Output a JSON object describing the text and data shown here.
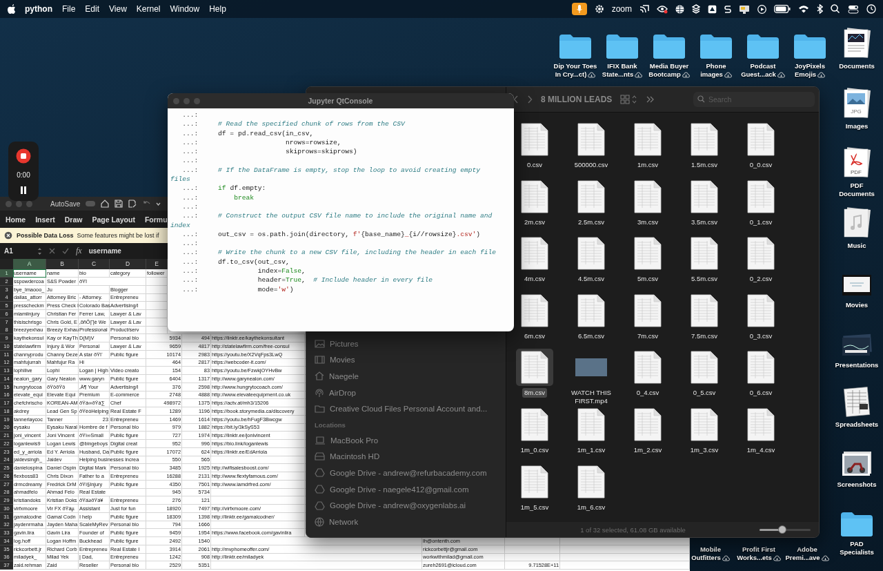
{
  "menubar": {
    "app": "python",
    "menus": [
      "File",
      "Edit",
      "View",
      "Kernel",
      "Window",
      "Help"
    ],
    "status_text": "zoom"
  },
  "desktop": {
    "top_row": [
      {
        "lines": [
          "Dip Your Toes",
          "In Cry...ct)"
        ],
        "cloud": true
      },
      {
        "lines": [
          "IFIX Bank",
          "State...nts"
        ],
        "cloud": true
      },
      {
        "lines": [
          "Media Buyer",
          "Bootcamp"
        ],
        "cloud": true
      },
      {
        "lines": [
          "Phone",
          "images"
        ],
        "cloud": true
      },
      {
        "lines": [
          "Podcast",
          "Guest...ack"
        ],
        "cloud": true
      },
      {
        "lines": [
          "JoyPixels",
          "Emojis"
        ],
        "cloud": true
      }
    ],
    "stacks": [
      {
        "lines": [
          "Documents"
        ],
        "kind": "documents"
      },
      {
        "lines": [
          "Images"
        ],
        "kind": "images",
        "icon_text": "JPG"
      },
      {
        "lines": [
          "PDF",
          "Documents"
        ],
        "kind": "pdf",
        "icon_text": "PDF"
      },
      {
        "lines": [
          "Music"
        ],
        "kind": "music"
      },
      {
        "lines": [
          "Movies"
        ],
        "kind": "movies"
      },
      {
        "lines": [
          "Presentations"
        ],
        "kind": "presentations"
      },
      {
        "lines": [
          "Spreadsheets"
        ],
        "kind": "spreadsheets"
      },
      {
        "lines": [
          "Screenshots"
        ],
        "kind": "screenshots"
      },
      {
        "lines": [
          "PAD",
          "Specialists"
        ],
        "kind": "folder"
      }
    ],
    "bottom_labels": [
      {
        "lines": [
          "Mobile",
          "Outfitters"
        ],
        "cloud": true
      },
      {
        "lines": [
          "Profit First",
          "Works...ets"
        ],
        "cloud": true
      },
      {
        "lines": [
          "Adobe",
          "Premi...ave"
        ],
        "cloud": true
      }
    ]
  },
  "recorder": {
    "time": "0:00"
  },
  "excel": {
    "autosave": "AutoSave",
    "autosave_on": false,
    "ribbon_tabs": [
      "Home",
      "Insert",
      "Draw",
      "Page Layout",
      "Formu"
    ],
    "alert": {
      "title": "Possible Data Loss",
      "message": "Some features might be lost if"
    },
    "name_box": "A1",
    "function_label": "fx",
    "formula": "username",
    "columns": [
      {
        "label": "A",
        "selected": true
      },
      {
        "label": "B",
        "selected": false
      },
      {
        "label": "C",
        "selected": false
      },
      {
        "label": "D",
        "selected": false
      },
      {
        "label": "E",
        "selected": false
      }
    ],
    "rows": [
      {
        "num": "1",
        "selected": true,
        "cells": [
          "username",
          "name",
          "bio",
          "category",
          "follower"
        ]
      },
      {
        "num": "2",
        "selected": false,
        "cells": [
          "sspowdercoa",
          "S&S Powder",
          "ðŸï",
          null
        ]
      },
      {
        "num": "3",
        "selected": false,
        "cells": [
          "bye_lmaooo_",
          "Ju",
          null,
          "Blogger"
        ]
      },
      {
        "num": "4",
        "selected": false,
        "cells": [
          "dallas_attorr",
          "Attorney Bric",
          "- Attorney.",
          "Entrepreneu"
        ]
      },
      {
        "num": "5",
        "selected": false,
        "cells": [
          "presscheckm",
          "Press Check I",
          "Colorado Bas",
          "Advertising/I"
        ]
      },
      {
        "num": "6",
        "selected": false,
        "cells": [
          "miamiinjury",
          "Christian Fer",
          "Ferrer Law,",
          "Lawyer & Lav"
        ]
      },
      {
        "num": "7",
        "selected": false,
        "cells": [
          "thisischrisgo",
          "Chris Gold, E",
          "‚õñÔ∏è We",
          "Lawyer & Lav"
        ]
      },
      {
        "num": "8",
        "selected": false,
        "cells": [
          "breezyexhau",
          "Breezy Exhau",
          "Professional",
          "Product/serv"
        ]
      },
      {
        "num": "9",
        "selected": false,
        "cells": [
          "kaythekonsul",
          "Kay or KayTh",
          "D(M)V",
          "Personal blo",
          "5934",
          "494",
          "https://linktr.ee/kaythekonsultant"
        ]
      },
      {
        "num": "10",
        "selected": false,
        "cells": [
          "statelawfirm",
          "Injury & Wor",
          "Personal",
          "Lawyer & Lav",
          "9659",
          "4817",
          "http://statelawfirm.com/free-consul"
        ]
      },
      {
        "num": "11",
        "selected": false,
        "cells": [
          "channyprodu",
          "Channy Deze",
          "A star ðŸï´",
          "Public figure",
          "10174",
          "2983",
          "https://youtu.be/X2VqFps3LwQ"
        ]
      },
      {
        "num": "12",
        "selected": false,
        "cells": [
          "mahfujurrah",
          "Mahfujur Ra",
          "Hi",
          null,
          "464",
          "2817",
          "https://webcoder-it.com/"
        ]
      },
      {
        "num": "13",
        "selected": false,
        "cells": [
          "lophilive",
          "Lophi",
          "Logan | High",
          "Video creato",
          "154",
          "83",
          "https://youtu.be/FzwkjOYHvBw"
        ]
      },
      {
        "num": "14",
        "selected": false,
        "cells": [
          "nealon_gary",
          "Gary Nealon",
          "www.garyn",
          "Public figure",
          "6404",
          "1317",
          "http://www.garynealon.com/"
        ]
      },
      {
        "num": "15",
        "selected": false,
        "cells": [
          "hungrytocoa",
          "ðŸôðŸô",
          "‚Ä¶ Your",
          "Advertising/I",
          "376",
          "2598",
          "http://www.hungrytocoach.com/"
        ]
      },
      {
        "num": "16",
        "selected": false,
        "cells": [
          "elevate_equi",
          "Elevate Equi",
          "Premium",
          "E-commerce",
          "2748",
          "4888",
          "http://www.elevateequipment.co.uk"
        ]
      },
      {
        "num": "17",
        "selected": false,
        "cells": [
          "chefchrischo",
          "KOREAN-AM",
          "ðŸá∞ðŸá∑",
          "Chef",
          "498972",
          "1375",
          "https://actv.at/mh3/15206"
        ]
      },
      {
        "num": "18",
        "selected": false,
        "cells": [
          "akdrey",
          "Lead Gen Sp",
          "ðŸèòHelping",
          "Real Estate F",
          "1289",
          "1196",
          "https://book.storymedia.ca/discovery"
        ]
      },
      {
        "num": "19",
        "selected": false,
        "cells": [
          "tannerlaycoc",
          "Tanner",
          "23",
          "Entrepreneu",
          "1469",
          "1614",
          "https://youtu.be/hFugF3Bwcgw"
        ]
      },
      {
        "num": "20",
        "selected": false,
        "cells": [
          "eysaku",
          "Eysaku Naral",
          "Hombre de f",
          "Personal blo",
          "979",
          "1882",
          "https://bit.ly/3kSyS53"
        ]
      },
      {
        "num": "21",
        "selected": false,
        "cells": [
          "joni_vincent",
          "Joni Vincent",
          "ðŸí∞Small",
          "Public figure",
          "727",
          "1974",
          "https://linktr.ee/jonivincent"
        ]
      },
      {
        "num": "22",
        "selected": false,
        "cells": [
          "loganlewis9",
          "Logan Lewis",
          "@bingeboys",
          "Digital creat",
          "952",
          "996",
          "https://bio.link/loganlewis"
        ]
      },
      {
        "num": "23",
        "selected": false,
        "cells": [
          "ed_y_arriola",
          "Ed Y. Arriola",
          "Husband, Da",
          "Public figure",
          "17072",
          "624",
          "https://linktr.ee/EdArriola"
        ]
      },
      {
        "num": "24",
        "selected": false,
        "cells": [
          "jaidevsingh_",
          "Jaidev",
          "Helping businesses increa",
          null,
          "550",
          "565"
        ]
      },
      {
        "num": "25",
        "selected": false,
        "cells": [
          "danielospina",
          "Daniel Ospin",
          "Digital Mark",
          "Personal blo",
          "3485",
          "1925",
          "http://wifisalesboost.com/"
        ]
      },
      {
        "num": "26",
        "selected": false,
        "cells": [
          "flexboss83",
          "Chris Dixon",
          "Father to a",
          "Entrepreneu",
          "16288",
          "2131",
          "http://www.flextyfamous.com/"
        ]
      },
      {
        "num": "27",
        "selected": false,
        "cells": [
          "drmcdreamy",
          "Fredrick DrM",
          "ðŸí§Injury",
          "Public figure",
          "4350",
          "7501",
          "http://www.iamdrfred.com/"
        ]
      },
      {
        "num": "28",
        "selected": false,
        "cells": [
          "ahmadfelo",
          "Ahmad Felo",
          "Real Estate",
          null,
          "945",
          "5734"
        ]
      },
      {
        "num": "29",
        "selected": false,
        "cells": [
          "kristiandoks",
          "Kristian Doks",
          "ðŸá≥ðŸá¥",
          "Entrepreneu",
          "276",
          "121"
        ]
      },
      {
        "num": "30",
        "selected": false,
        "cells": [
          "virfxmoore",
          "Vir FX ðŸáµ",
          "Assistant",
          "Just for fun",
          "18920",
          "7497",
          "http://virfxmoore.com/"
        ]
      },
      {
        "num": "31",
        "selected": false,
        "cells": [
          "gamalcodne",
          "Gamal Codn",
          "I help",
          "Public figure",
          "18309",
          "1398",
          "http://linktr.ee/gamalcodner/"
        ]
      },
      {
        "num": "32",
        "selected": false,
        "cells": [
          "jaydenrmaha",
          "Jayden Maha",
          "ScaleMyRev",
          "Personal blo",
          "794",
          "1666"
        ]
      },
      {
        "num": "33",
        "selected": false,
        "cells": [
          "gavin.lira",
          "Gavin Lira",
          "Founder of",
          "Public figure",
          "9459",
          "1954",
          "https://www.facebook.com/gavinlira"
        ]
      },
      {
        "num": "34",
        "selected": false,
        "cells": [
          "log.hoff",
          "Logan Hoffm",
          "Buckhead",
          "Public figure",
          "2492",
          "1540",
          null,
          "lh@ontenth.com"
        ]
      },
      {
        "num": "35",
        "selected": false,
        "cells": [
          "rickcorbett.jr",
          "Richard Corb",
          "Entrepreneu",
          "Real Estate I",
          "3914",
          "2061",
          "http://mvphomeoffer.com/",
          "rickcorbettjr@gmail.com"
        ]
      },
      {
        "num": "36",
        "selected": false,
        "cells": [
          "miladyek_",
          "Milad Yek",
          "| Dad,",
          "Entrepreneu",
          "1242",
          "908",
          "http://linktr.ee/miladyek",
          "workwithmilad@gmail.com"
        ]
      },
      {
        "num": "37",
        "selected": false,
        "cells": [
          "zaid.rehman",
          "Zaid",
          "Reseller",
          "Personal blo",
          "2529",
          "5351",
          null,
          "zureh2691@icloud.com",
          "9.71528E+11"
        ]
      }
    ]
  },
  "jupyter": {
    "title": "Jupyter QtConsole",
    "lines": [
      {
        "prompt": "   ...:"
      },
      {
        "prompt": "   ...:",
        "parts": [
          {
            "kind": "comment",
            "text": "     # Read the specified chunk of rows from the CSV"
          }
        ]
      },
      {
        "prompt": "   ...:",
        "parts": [
          {
            "kind": "code",
            "text": "     df = pd.read_csv(in_csv,"
          }
        ]
      },
      {
        "prompt": "   ...:",
        "parts": [
          {
            "kind": "code",
            "text": "                      nrows=rowsize,"
          }
        ]
      },
      {
        "prompt": "   ...:",
        "parts": [
          {
            "kind": "code",
            "text": "                      skiprows=skiprows)"
          }
        ]
      },
      {
        "prompt": "   ...:"
      },
      {
        "prompt": "   ...:",
        "parts": [
          {
            "kind": "comment",
            "text": "     # If the DataFrame is empty, stop the loop to avoid creating empty"
          }
        ]
      },
      {
        "parts": [
          {
            "kind": "comment",
            "text": "files"
          }
        ]
      },
      {
        "prompt": "   ...:",
        "parts": [
          {
            "kind": "keyword",
            "text": "     if"
          },
          {
            "kind": "code",
            "text": " df.empty:"
          }
        ]
      },
      {
        "prompt": "   ...:",
        "parts": [
          {
            "kind": "keyword",
            "text": "         break"
          }
        ]
      },
      {
        "prompt": "   ...:"
      },
      {
        "prompt": "   ...:",
        "parts": [
          {
            "kind": "comment",
            "text": "     # Construct the output CSV file name to include the original name and"
          }
        ]
      },
      {
        "parts": [
          {
            "kind": "comment",
            "text": "index"
          }
        ]
      },
      {
        "prompt": "   ...:",
        "parts": [
          {
            "kind": "code",
            "text": "     out_csv = os.path.join(directory, "
          },
          {
            "kind": "string",
            "text": "f'"
          },
          {
            "kind": "code",
            "text": "{base_name}"
          },
          {
            "kind": "string",
            "text": "_"
          },
          {
            "kind": "code",
            "text": "{i//rowsize}"
          },
          {
            "kind": "string",
            "text": ".csv'"
          },
          {
            "kind": "code",
            "text": ")"
          }
        ]
      },
      {
        "prompt": "   ...:"
      },
      {
        "prompt": "   ...:",
        "parts": [
          {
            "kind": "comment",
            "text": "     # Write the chunk to a new CSV file, including the header in each file"
          }
        ]
      },
      {
        "prompt": "   ...:",
        "parts": [
          {
            "kind": "code",
            "text": "     df.to_csv(out_csv,"
          }
        ]
      },
      {
        "prompt": "   ...:",
        "parts": [
          {
            "kind": "code",
            "text": "               index="
          },
          {
            "kind": "keyword",
            "text": "False"
          },
          {
            "kind": "code",
            "text": ","
          }
        ]
      },
      {
        "prompt": "   ...:",
        "parts": [
          {
            "kind": "code",
            "text": "               header="
          },
          {
            "kind": "keyword",
            "text": "True"
          },
          {
            "kind": "code",
            "text": ",  "
          },
          {
            "kind": "comment",
            "text": "# Include header in every file"
          }
        ]
      },
      {
        "prompt": "   ...:",
        "parts": [
          {
            "kind": "code",
            "text": "               mode="
          },
          {
            "kind": "string",
            "text": "'w'"
          },
          {
            "kind": "code",
            "text": ")"
          }
        ]
      }
    ]
  },
  "finder": {
    "title": "8 MILLION LEADS",
    "search_placeholder": "Search",
    "favorites": [
      {
        "label": "Pictures",
        "kind": "pictures"
      },
      {
        "label": "Movies",
        "kind": "movies"
      },
      {
        "label": "Naegele",
        "kind": "home"
      },
      {
        "label": "AirDrop",
        "kind": "airdrop"
      },
      {
        "label": "Creative Cloud Files Personal Account and...",
        "kind": "folder"
      }
    ],
    "locations_heading": "Locations",
    "locations": [
      {
        "label": "MacBook Pro",
        "kind": "laptop"
      },
      {
        "label": "Macintosh HD",
        "kind": "disk"
      },
      {
        "label": "Google Drive - andrew@refurbacademy.com",
        "kind": "drive"
      },
      {
        "label": "Google Drive - naegele412@gmail.com",
        "kind": "drive"
      },
      {
        "label": "Google Drive - andrew@oxygenlabs.ai",
        "kind": "drive"
      },
      {
        "label": "Network",
        "kind": "network"
      }
    ],
    "files": [
      {
        "name": "0.csv",
        "kind": "csv",
        "selected": false
      },
      {
        "name": "500000.csv",
        "kind": "csv",
        "selected": false
      },
      {
        "name": "1m.csv",
        "kind": "csv",
        "selected": false
      },
      {
        "name": "1.5m.csv",
        "kind": "csv",
        "selected": false
      },
      {
        "name": "0_0.csv",
        "kind": "csv",
        "selected": false
      },
      {
        "name": "2m.csv",
        "kind": "csv",
        "selected": false
      },
      {
        "name": "2.5m.csv",
        "kind": "csv",
        "selected": false
      },
      {
        "name": "3m.csv",
        "kind": "csv",
        "selected": false
      },
      {
        "name": "3.5m.csv",
        "kind": "csv",
        "selected": false
      },
      {
        "name": "0_1.csv",
        "kind": "csv",
        "selected": false
      },
      {
        "name": "4m.csv",
        "kind": "csv",
        "selected": false
      },
      {
        "name": "4.5m.csv",
        "kind": "csv",
        "selected": false
      },
      {
        "name": "5m.csv",
        "kind": "csv",
        "selected": false
      },
      {
        "name": "5.5m.csv",
        "kind": "csv",
        "selected": false
      },
      {
        "name": "0_2.csv",
        "kind": "csv",
        "selected": false
      },
      {
        "name": "6m.csv",
        "kind": "csv",
        "selected": false
      },
      {
        "name": "6.5m.csv",
        "kind": "csv",
        "selected": false
      },
      {
        "name": "7m.csv",
        "kind": "csv",
        "selected": false
      },
      {
        "name": "7.5m.csv",
        "kind": "csv",
        "selected": false
      },
      {
        "name": "0_3.csv",
        "kind": "csv",
        "selected": false
      },
      {
        "name": "8m.csv",
        "kind": "csv",
        "selected": true
      },
      {
        "name": "WATCH THIS FIRST.mp4",
        "kind": "video",
        "selected": false
      },
      {
        "name": "0_4.csv",
        "kind": "csv",
        "selected": false
      },
      {
        "name": "0_5.csv",
        "kind": "csv",
        "selected": false
      },
      {
        "name": "0_6.csv",
        "kind": "csv",
        "selected": false
      },
      {
        "name": "1m_0.csv",
        "kind": "csv",
        "selected": false
      },
      {
        "name": "1m_1.csv",
        "kind": "csv",
        "selected": false
      },
      {
        "name": "1m_2.csv",
        "kind": "csv",
        "selected": false
      },
      {
        "name": "1m_3.csv",
        "kind": "csv",
        "selected": false
      },
      {
        "name": "1m_4.csv",
        "kind": "csv",
        "selected": false
      },
      {
        "name": "1m_5.csv",
        "kind": "csv",
        "selected": false
      },
      {
        "name": "1m_6.csv",
        "kind": "csv",
        "selected": false
      }
    ],
    "status": "1 of 32 selected, 61.08 GB available",
    "icon_size": {
      "level": 0.45
    }
  }
}
